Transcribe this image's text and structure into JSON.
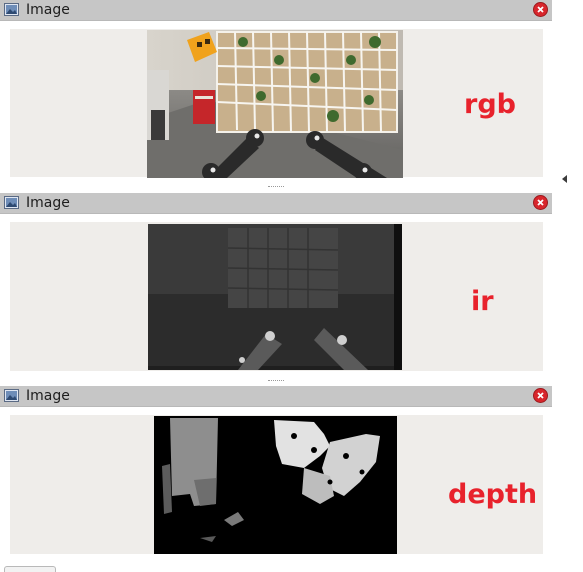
{
  "panels": [
    {
      "title": "Image",
      "label": "rgb",
      "close_icon": "close-icon",
      "window_icon": "image-window-icon"
    },
    {
      "title": "Image",
      "label": "ir",
      "close_icon": "close-icon",
      "window_icon": "image-window-icon"
    },
    {
      "title": "Image",
      "label": "depth",
      "close_icon": "close-icon",
      "window_icon": "image-window-icon"
    }
  ],
  "colors": {
    "label": "#e8222c",
    "titlebar": "#c6c6c6",
    "content_bg": "#efedea",
    "close_button": "#d8262c"
  },
  "icons": [
    "image-window-icon",
    "close-icon",
    "collapse-arrow-icon",
    "splitter-grip-icon"
  ]
}
